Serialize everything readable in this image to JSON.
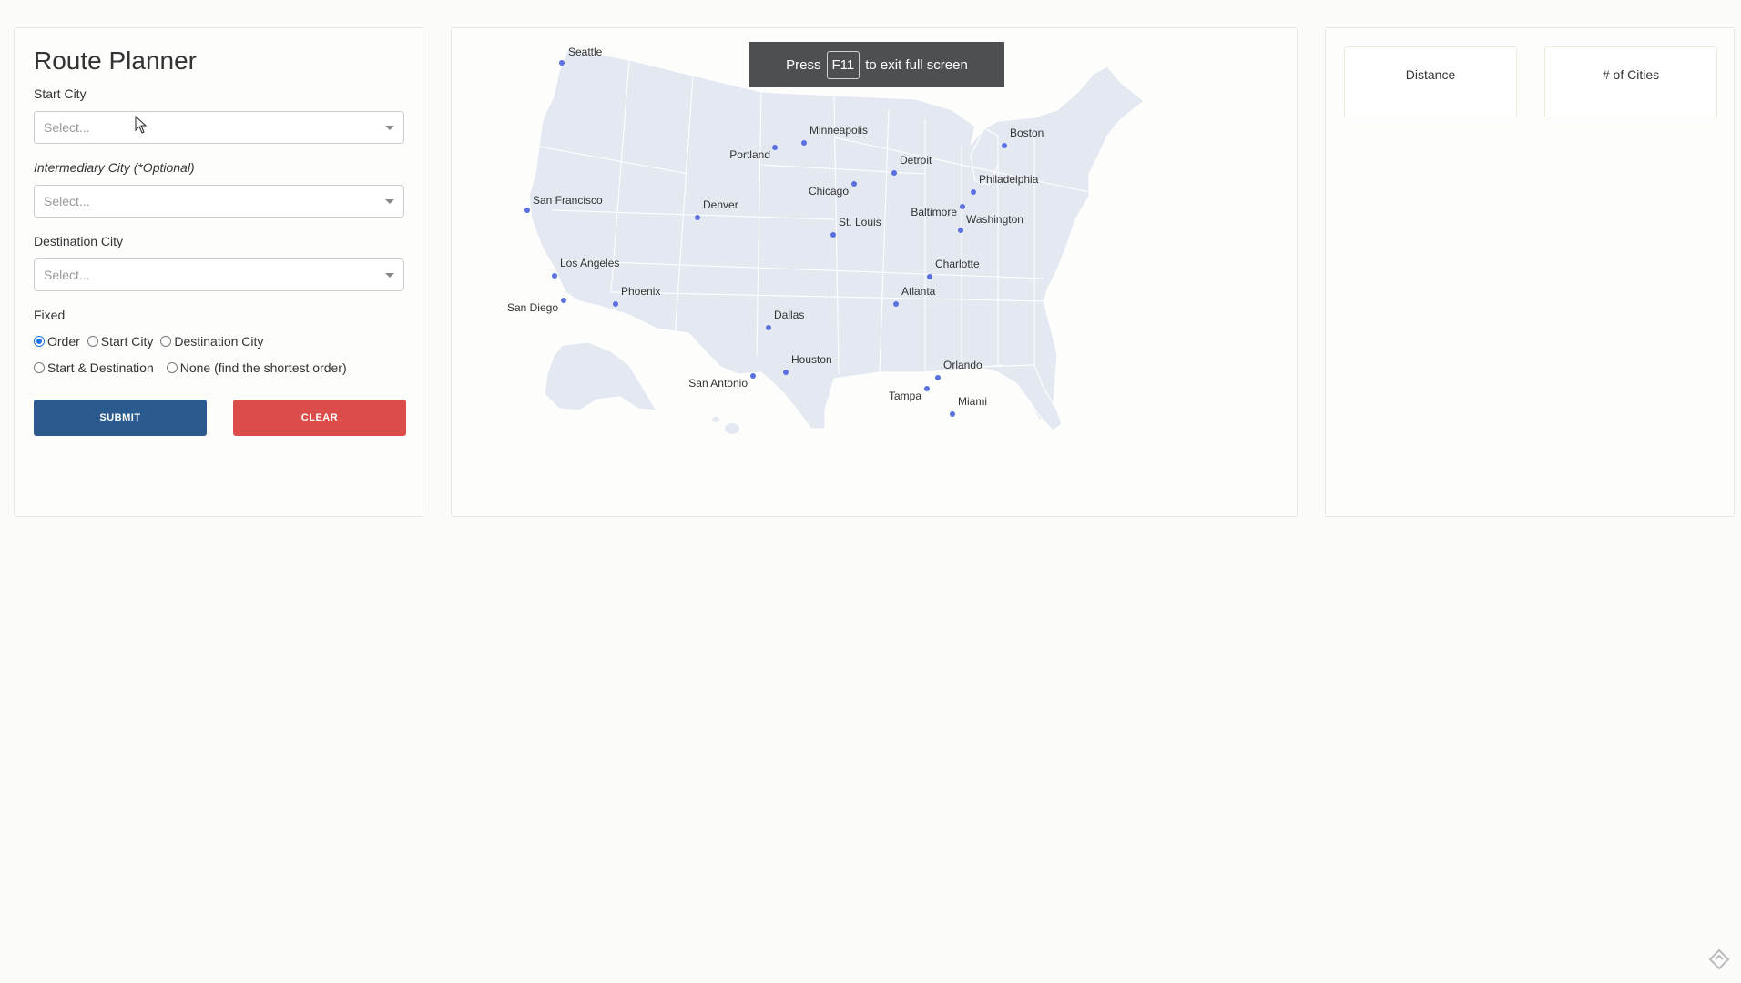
{
  "app": {
    "title": "Route Planner"
  },
  "form": {
    "start_city": {
      "label": "Start City",
      "placeholder": "Select..."
    },
    "intermediary_city": {
      "label": "Intermediary City (*Optional)",
      "placeholder": "Select..."
    },
    "destination_city": {
      "label": "Destination City",
      "placeholder": "Select..."
    },
    "fixed": {
      "label": "Fixed",
      "options": [
        "Order",
        "Start City",
        "Destination City",
        "Start & Destination",
        "None (find the shortest order)"
      ],
      "selected": "Order"
    },
    "submit_label": "SUBMIT",
    "clear_label": "CLEAR"
  },
  "stats": {
    "distance_label": "Distance",
    "cities_label": "# of Cities"
  },
  "fullscreen_banner": {
    "prefix": "Press",
    "key": "F11",
    "suffix": "to exit full screen"
  },
  "map": {
    "cities": [
      "Seattle",
      "Portland",
      "Minneapolis",
      "Boston",
      "Detroit",
      "Philadelphia",
      "San Francisco",
      "Denver",
      "Chicago",
      "Baltimore",
      "Washington",
      "St. Louis",
      "Los Angeles",
      "Charlotte",
      "Phoenix",
      "Atlanta",
      "San Diego",
      "Dallas",
      "Houston",
      "Orlando",
      "San Antonio",
      "Tampa",
      "Miami"
    ]
  },
  "colors": {
    "submit": "#2b5b8e",
    "clear": "#db4d4a",
    "city_dot": "#5a6fe0",
    "land": "#e4e9f1"
  }
}
